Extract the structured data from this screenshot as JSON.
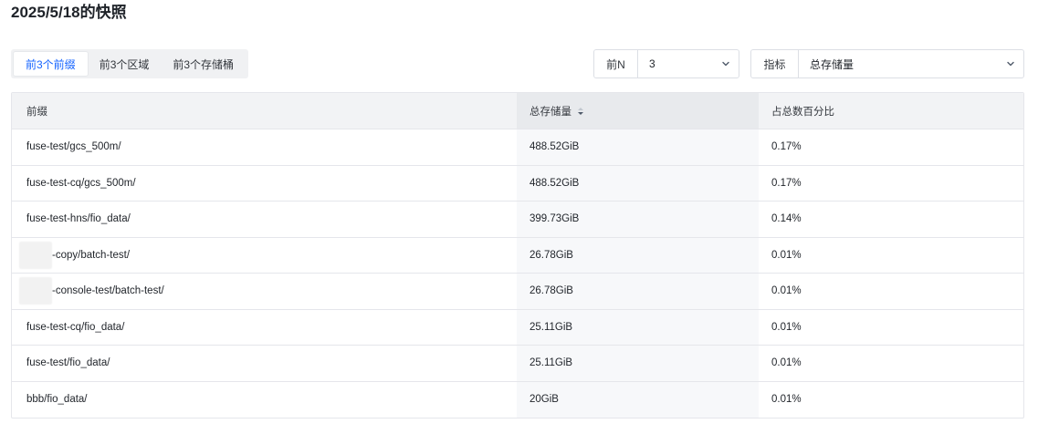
{
  "page_title": "2025/5/18的快照",
  "tabs": [
    {
      "label": "前3个前缀",
      "active": true
    },
    {
      "label": "前3个区域",
      "active": false
    },
    {
      "label": "前3个存储桶",
      "active": false
    }
  ],
  "topn_select": {
    "prefix": "前N",
    "value": "3"
  },
  "metric_select": {
    "prefix": "指标",
    "value": "总存储量"
  },
  "table": {
    "headers": [
      "前缀",
      "总存储量",
      "占总数百分比"
    ],
    "sort_column": "总存储量",
    "sort_direction": "descending",
    "rows": [
      {
        "prefix": "fuse-test/gcs_500m/",
        "storage": "488.52GiB",
        "percent": "0.17%",
        "redacted": false
      },
      {
        "prefix": "fuse-test-cq/gcs_500m/",
        "storage": "488.52GiB",
        "percent": "0.17%",
        "redacted": false
      },
      {
        "prefix": "fuse-test-hns/fio_data/",
        "storage": "399.73GiB",
        "percent": "0.14%",
        "redacted": false
      },
      {
        "prefix": "-copy/batch-test/",
        "storage": "26.78GiB",
        "percent": "0.01%",
        "redacted": true
      },
      {
        "prefix": "-console-test/batch-test/",
        "storage": "26.78GiB",
        "percent": "0.01%",
        "redacted": true
      },
      {
        "prefix": "fuse-test-cq/fio_data/",
        "storage": "25.11GiB",
        "percent": "0.01%",
        "redacted": false
      },
      {
        "prefix": "fuse-test/fio_data/",
        "storage": "25.11GiB",
        "percent": "0.01%",
        "redacted": false
      },
      {
        "prefix": "bbb/fio_data/",
        "storage": "20GiB",
        "percent": "0.01%",
        "redacted": false
      }
    ]
  },
  "colors": {
    "accent": "#1664ff",
    "header_bg": "#f2f3f5",
    "border": "#e5e6eb"
  },
  "icons": {
    "select_chevron": "chevron-down-icon",
    "sort": "sort-caret-icon"
  }
}
